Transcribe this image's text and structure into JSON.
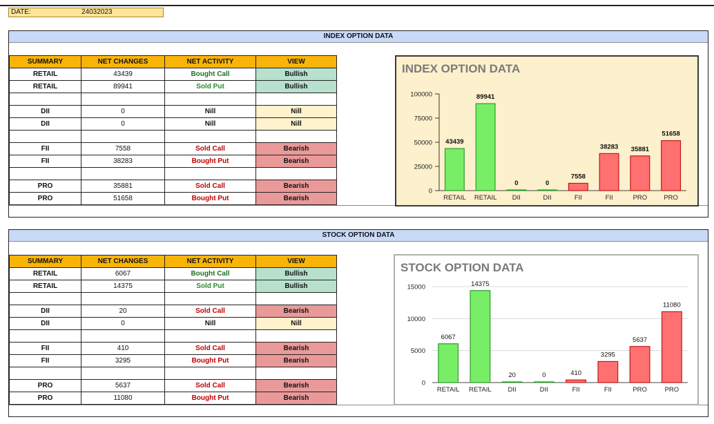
{
  "date": {
    "label": "DATE:",
    "value": "24032023"
  },
  "index": {
    "title": "INDEX OPTION DATA",
    "headers": [
      "SUMMARY",
      "NET CHANGES",
      "NET ACTIVITY",
      "VIEW"
    ],
    "rows": [
      {
        "summary": "RETAIL",
        "net": "43439",
        "activity": "Bought Call",
        "view": "Bullish"
      },
      {
        "summary": "RETAIL",
        "net": "89941",
        "activity": "Sold Put",
        "view": "Bullish"
      },
      {
        "summary": "",
        "net": "",
        "activity": "",
        "view": ""
      },
      {
        "summary": "DII",
        "net": "0",
        "activity": "Nill",
        "view": "Nill"
      },
      {
        "summary": "DII",
        "net": "0",
        "activity": "Nill",
        "view": "Nill"
      },
      {
        "summary": "",
        "net": "",
        "activity": "",
        "view": ""
      },
      {
        "summary": "FII",
        "net": "7558",
        "activity": "Sold Call",
        "view": "Bearish"
      },
      {
        "summary": "FII",
        "net": "38283",
        "activity": "Bought Put",
        "view": "Bearish"
      },
      {
        "summary": "",
        "net": "",
        "activity": "",
        "view": ""
      },
      {
        "summary": "PRO",
        "net": "35881",
        "activity": "Sold Call",
        "view": "Bearish"
      },
      {
        "summary": "PRO",
        "net": "51658",
        "activity": "Bought Put",
        "view": "Bearish"
      }
    ]
  },
  "stock": {
    "title": "STOCK OPTION DATA",
    "headers": [
      "SUMMARY",
      "NET CHANGES",
      "NET ACTIVITY",
      "VIEW"
    ],
    "rows": [
      {
        "summary": "RETAIL",
        "net": "6067",
        "activity": "Bought Call",
        "view": "Bullish"
      },
      {
        "summary": "RETAIL",
        "net": "14375",
        "activity": "Sold Put",
        "view": "Bullish"
      },
      {
        "summary": "",
        "net": "",
        "activity": "",
        "view": ""
      },
      {
        "summary": "DII",
        "net": "20",
        "activity": "Sold Call",
        "view": "Bearish"
      },
      {
        "summary": "DII",
        "net": "0",
        "activity": "Nill",
        "view": "Nill"
      },
      {
        "summary": "",
        "net": "",
        "activity": "",
        "view": ""
      },
      {
        "summary": "FII",
        "net": "410",
        "activity": "Sold Call",
        "view": "Bearish"
      },
      {
        "summary": "FII",
        "net": "3295",
        "activity": "Bought Put",
        "view": "Bearish"
      },
      {
        "summary": "",
        "net": "",
        "activity": "",
        "view": ""
      },
      {
        "summary": "PRO",
        "net": "5637",
        "activity": "Sold Call",
        "view": "Bearish"
      },
      {
        "summary": "PRO",
        "net": "11080",
        "activity": "Bought Put",
        "view": "Bearish"
      }
    ]
  },
  "colors": {
    "header_orange": "#f9b409",
    "title_blue": "#c9daf8",
    "bullish_bg": "#b7e1cd",
    "bearish_bg": "#ea9999",
    "nill_bg": "#fff2cc",
    "bar_green": "#77ee66",
    "bar_green_stroke": "#2f9a2f",
    "bar_red": "#ff7070",
    "bar_red_stroke": "#c01818"
  },
  "chart_data": [
    {
      "type": "bar",
      "title": "INDEX OPTION DATA",
      "categories": [
        "RETAIL",
        "RETAIL",
        "DII",
        "DII",
        "FII",
        "FII",
        "PRO",
        "PRO"
      ],
      "values": [
        43439,
        89941,
        0,
        0,
        7558,
        38283,
        35881,
        51658
      ],
      "bar_colors": [
        "green",
        "green",
        "green",
        "green",
        "red",
        "red",
        "red",
        "red"
      ],
      "ylim": [
        0,
        100000
      ],
      "yticks": [
        0,
        25000,
        50000,
        75000,
        100000
      ],
      "data_labels_bold": true,
      "background": "#fdf0cc",
      "grid": false
    },
    {
      "type": "bar",
      "title": "STOCK OPTION DATA",
      "categories": [
        "RETAIL",
        "RETAIL",
        "DII",
        "DII",
        "FII",
        "FII",
        "PRO",
        "PRO"
      ],
      "values": [
        6067,
        14375,
        20,
        0,
        410,
        3295,
        5637,
        11080
      ],
      "bar_colors": [
        "green",
        "green",
        "green",
        "green",
        "red",
        "red",
        "red",
        "red"
      ],
      "ylim": [
        0,
        15000
      ],
      "yticks": [
        0,
        5000,
        10000,
        15000
      ],
      "data_labels_bold": false,
      "background": "#ffffff",
      "grid": true
    }
  ]
}
